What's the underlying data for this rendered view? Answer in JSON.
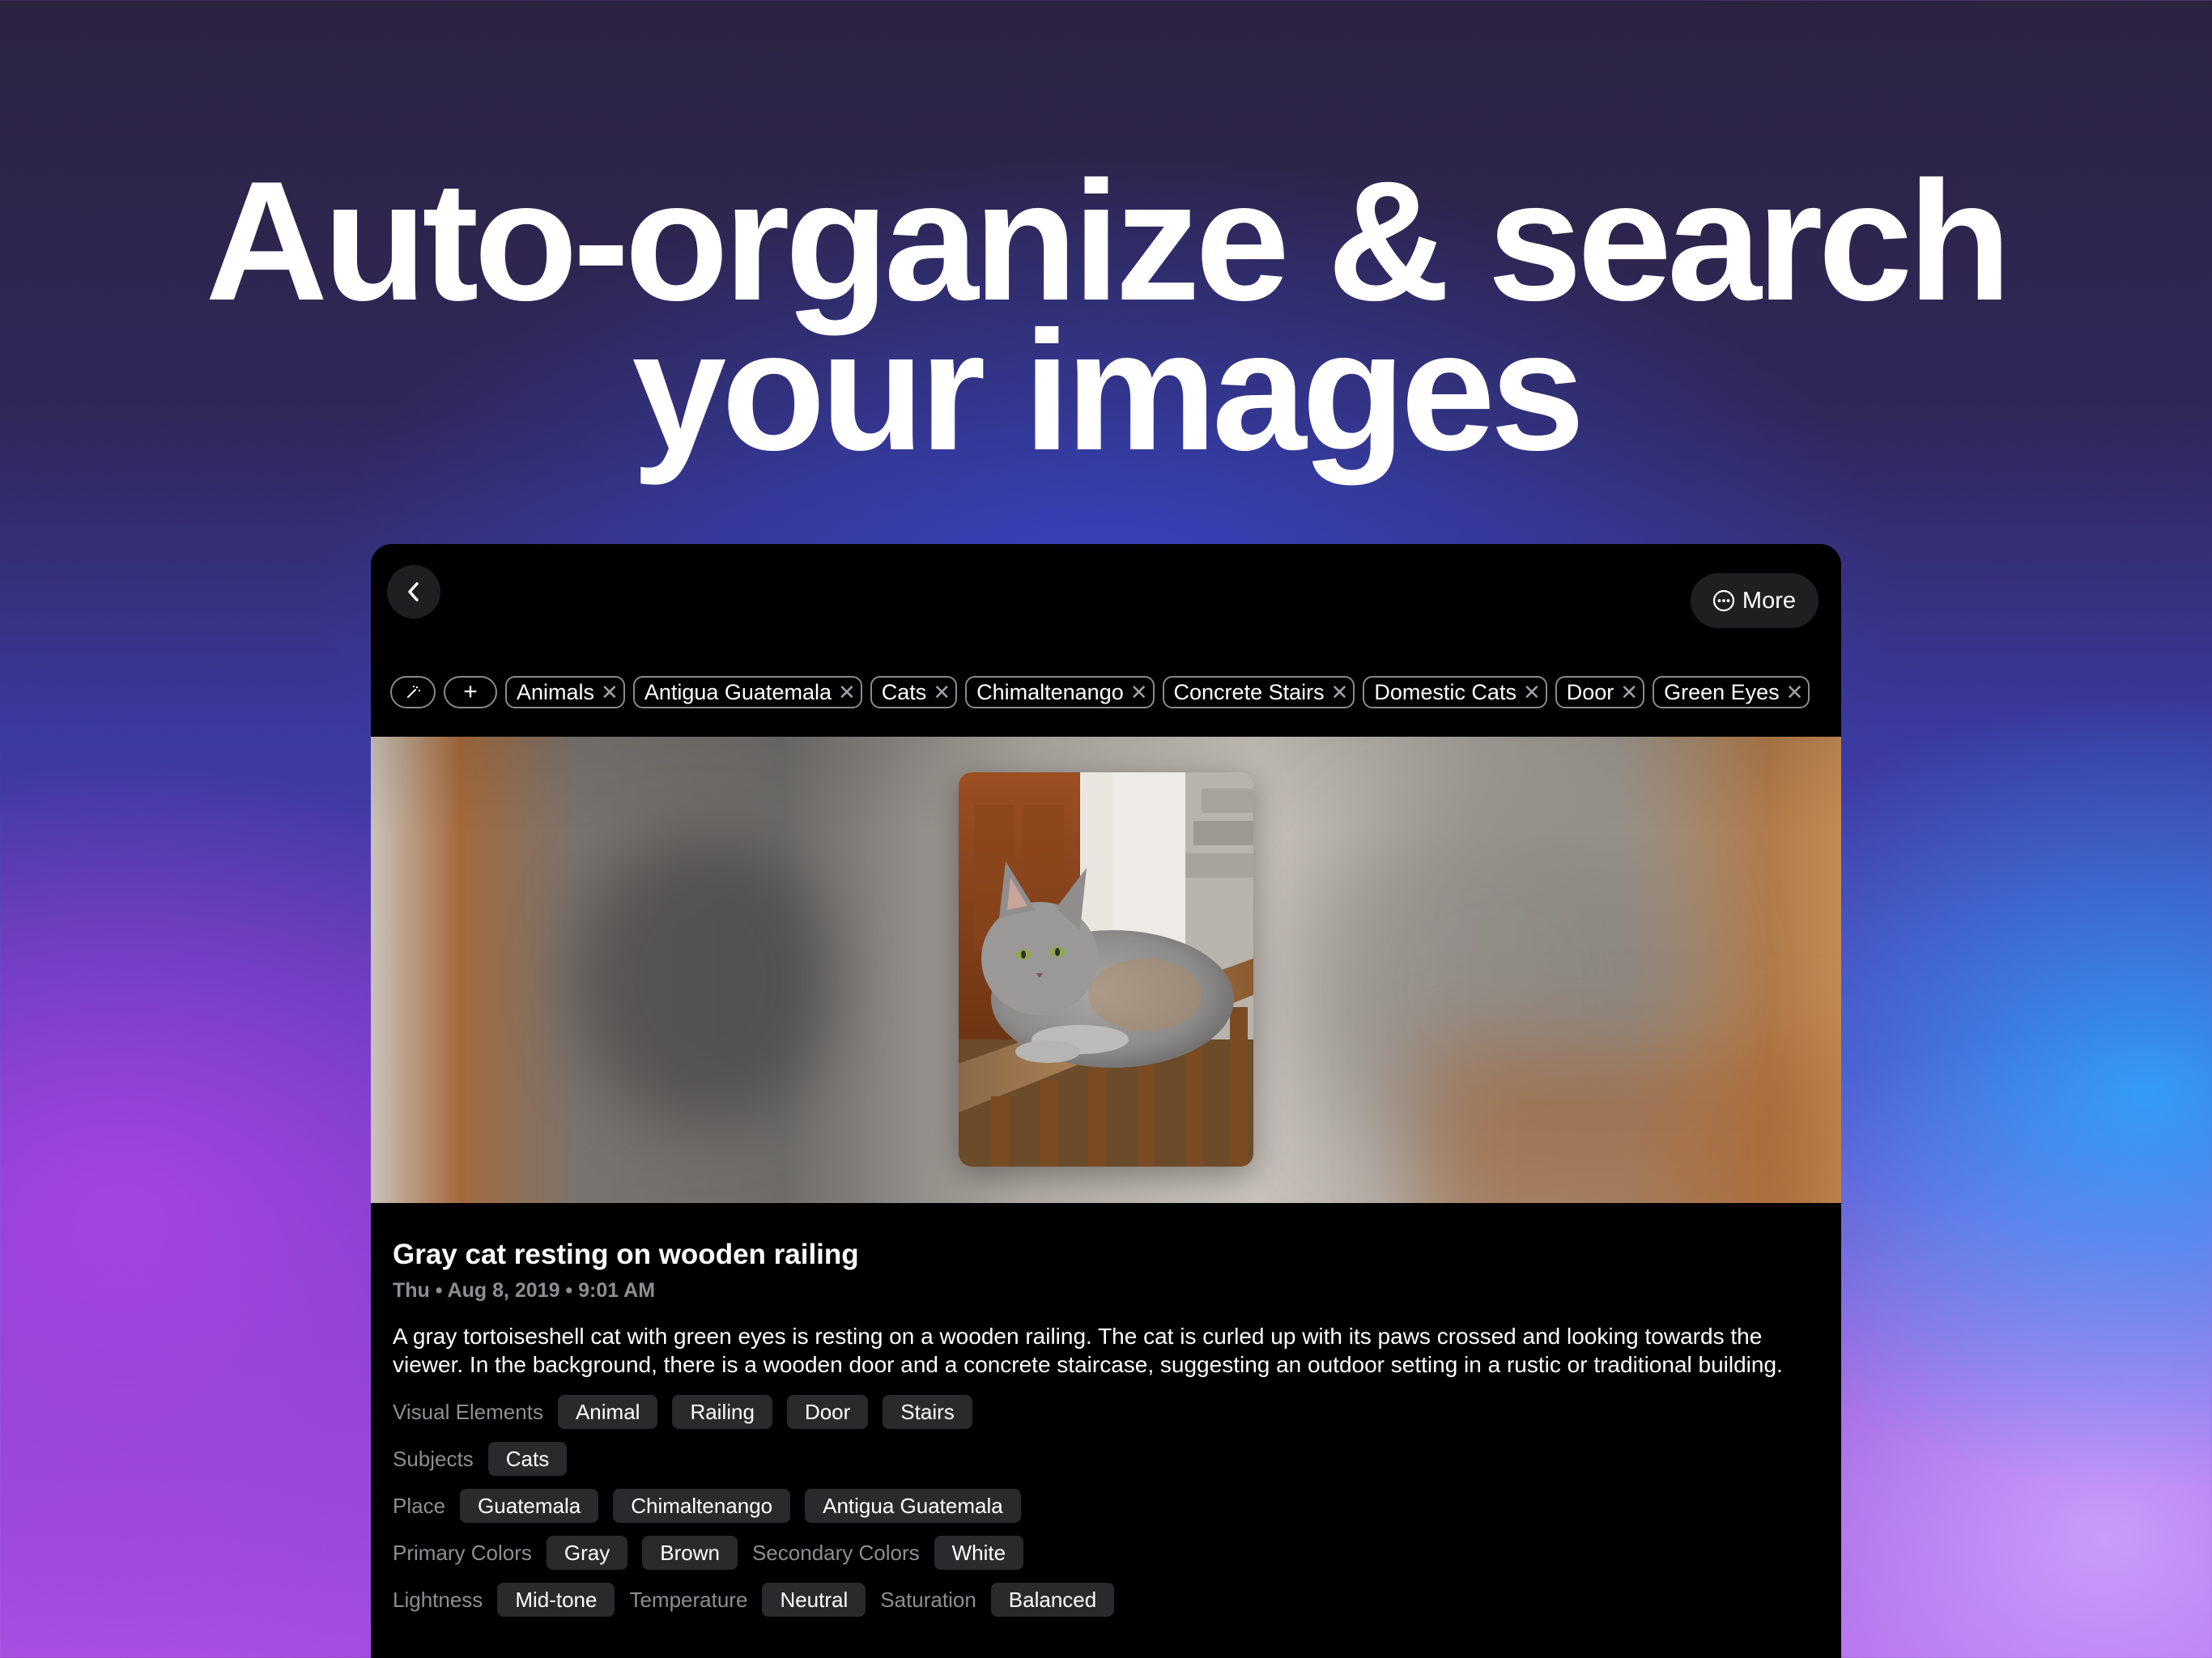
{
  "headline": {
    "line1": "Auto-organize &  search",
    "line2": "your images"
  },
  "window": {
    "more_label": "More",
    "tag_chips": [
      "Animals",
      "Antigua Guatemala",
      "Cats",
      "Chimaltenango",
      "Concrete Stairs",
      "Domestic Cats",
      "Door",
      "Green Eyes"
    ],
    "chip_close_glyph": "✕",
    "add_glyph": "+",
    "photo": {
      "title": "Gray cat resting on wooden railing",
      "date": "Thu • Aug 8, 2019 • 9:01 AM",
      "description": "A gray tortoiseshell cat with green eyes is resting on a wooden railing. The cat is curled up with its paws crossed and looking towards the viewer. In the background, there is a wooden door and a concrete staircase, suggesting an outdoor setting in a rustic or traditional building."
    },
    "attributes": {
      "visual_elements": {
        "label": "Visual Elements",
        "values": [
          "Animal",
          "Railing",
          "Door",
          "Stairs"
        ]
      },
      "subjects": {
        "label": "Subjects",
        "values": [
          "Cats"
        ]
      },
      "place": {
        "label": "Place",
        "values": [
          "Guatemala",
          "Chimaltenango",
          "Antigua Guatemala"
        ]
      },
      "primary_colors": {
        "label": "Primary Colors",
        "values": [
          "Gray",
          "Brown"
        ]
      },
      "secondary_colors": {
        "label": "Secondary Colors",
        "values": [
          "White"
        ]
      },
      "lightness": {
        "label": "Lightness",
        "value": "Mid-tone"
      },
      "temperature": {
        "label": "Temperature",
        "value": "Neutral"
      },
      "saturation": {
        "label": "Saturation",
        "value": "Balanced"
      }
    }
  },
  "colors": {
    "background_top": "#2b2340",
    "window_bg": "#000000",
    "pill_bg": "#2a2a2c",
    "muted_text": "#8e8e93"
  },
  "icons": [
    "chevron-left-icon",
    "ellipsis-circle-icon",
    "magic-wand-icon",
    "plus-icon",
    "close-icon"
  ]
}
